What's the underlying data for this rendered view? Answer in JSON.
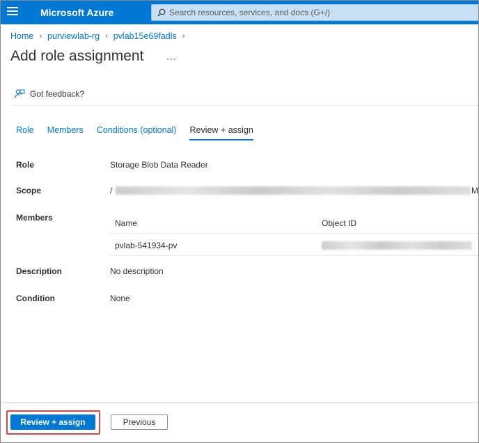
{
  "topbar": {
    "brand": "Microsoft Azure",
    "search_placeholder": "Search resources, services, and docs (G+/)"
  },
  "breadcrumb": [
    "Home",
    "purviewlab-rg",
    "pvlab15e69fadls"
  ],
  "page": {
    "title": "Add role assignment",
    "more": "..."
  },
  "feedback_label": "Got feedback?",
  "tabs": [
    {
      "label": "Role",
      "active": false
    },
    {
      "label": "Members",
      "active": false
    },
    {
      "label": "Conditions (optional)",
      "active": false
    },
    {
      "label": "Review + assign",
      "active": true
    }
  ],
  "details": {
    "role_label": "Role",
    "role_value": "Storage Blob Data Reader",
    "scope_label": "Scope",
    "scope_prefix": "/",
    "scope_tail": "Mi",
    "members_label": "Members",
    "members_table": {
      "headers": [
        "Name",
        "Object ID"
      ],
      "rows": [
        {
          "name": "pvlab-541934-pv"
        }
      ]
    },
    "description_label": "Description",
    "description_value": "No description",
    "condition_label": "Condition",
    "condition_value": "None"
  },
  "footer": {
    "primary_label": "Review + assign",
    "secondary_label": "Previous"
  },
  "colors": {
    "accent": "#0078d4",
    "highlight": "#e04344"
  }
}
